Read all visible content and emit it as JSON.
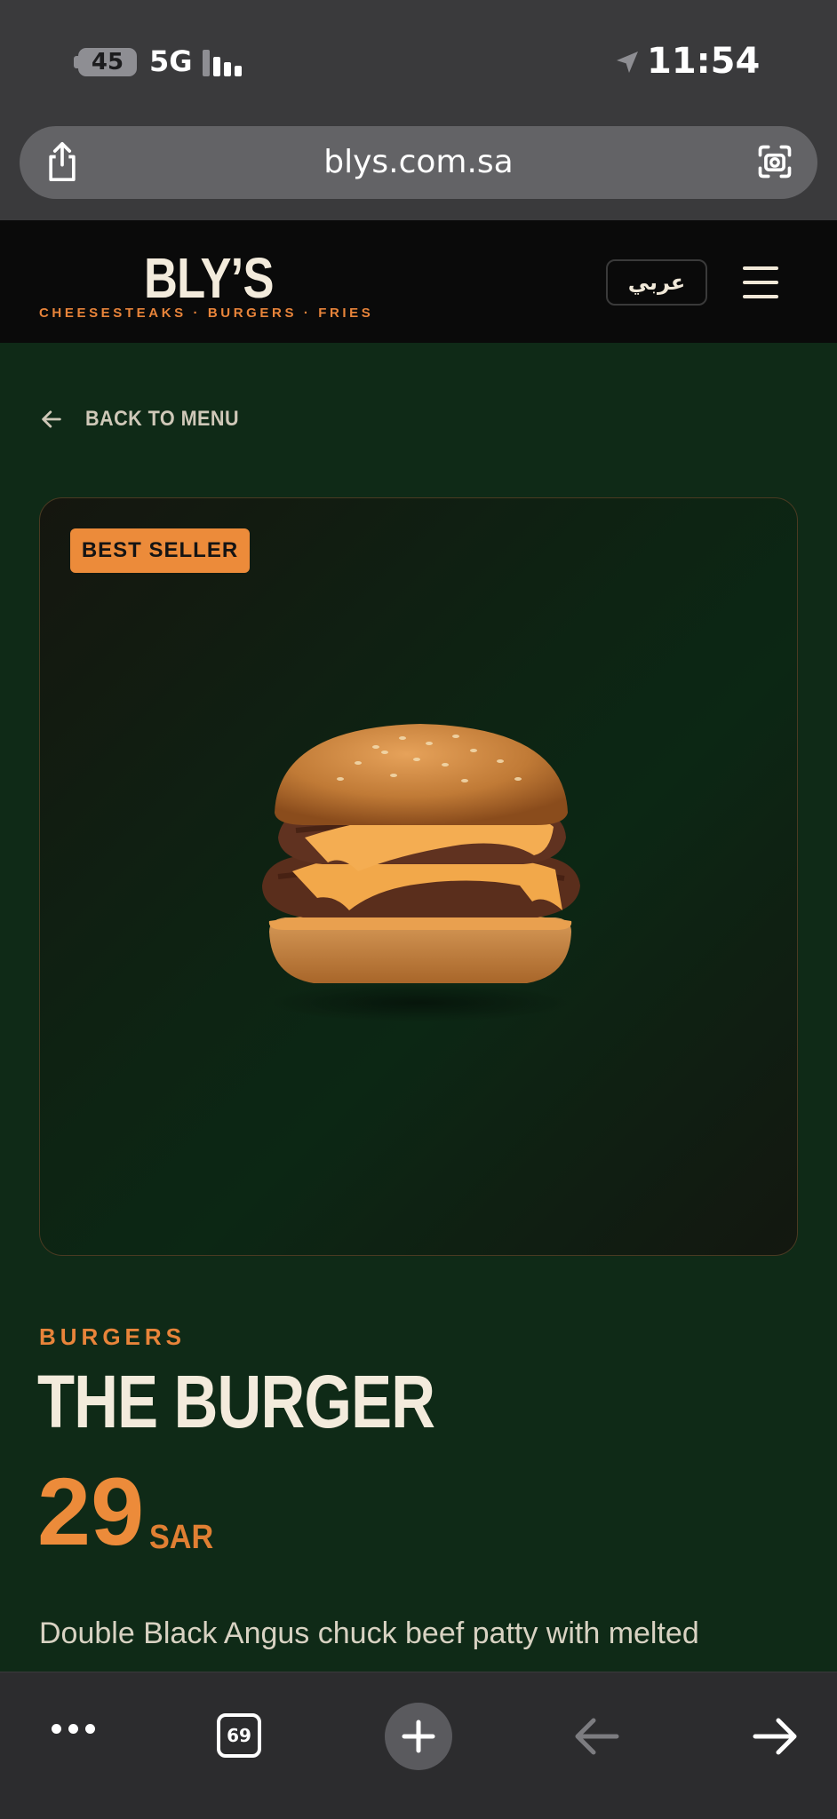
{
  "status_bar": {
    "battery": "45",
    "network": "5G",
    "time": "11:54"
  },
  "browser": {
    "url": "blys.com.sa",
    "tabs_count": "69"
  },
  "header": {
    "logo": "BLY’S",
    "tagline": "CHEESESTEAKS · BURGERS · FRIES",
    "language_button": "عربي"
  },
  "main": {
    "back_label": "BACK TO MENU",
    "badge": "BEST SELLER",
    "category": "BURGERS",
    "product_name": "THE BURGER",
    "price": "29",
    "currency": "SAR",
    "description": "Double Black Angus chuck beef patty with melted"
  },
  "colors": {
    "accent": "#ec8b3a",
    "page_background": "#0f2a17",
    "header_background": "#0a0a0a",
    "cream_text": "#f3ebdc"
  },
  "icons": {
    "share": "share-icon",
    "lens": "visual-lookup-icon",
    "menu": "hamburger-menu-icon",
    "back": "arrow-left-icon",
    "more": "more-dots-icon",
    "new_tab": "plus-icon",
    "nav_back": "arrow-left-icon",
    "nav_forward": "arrow-right-icon"
  }
}
